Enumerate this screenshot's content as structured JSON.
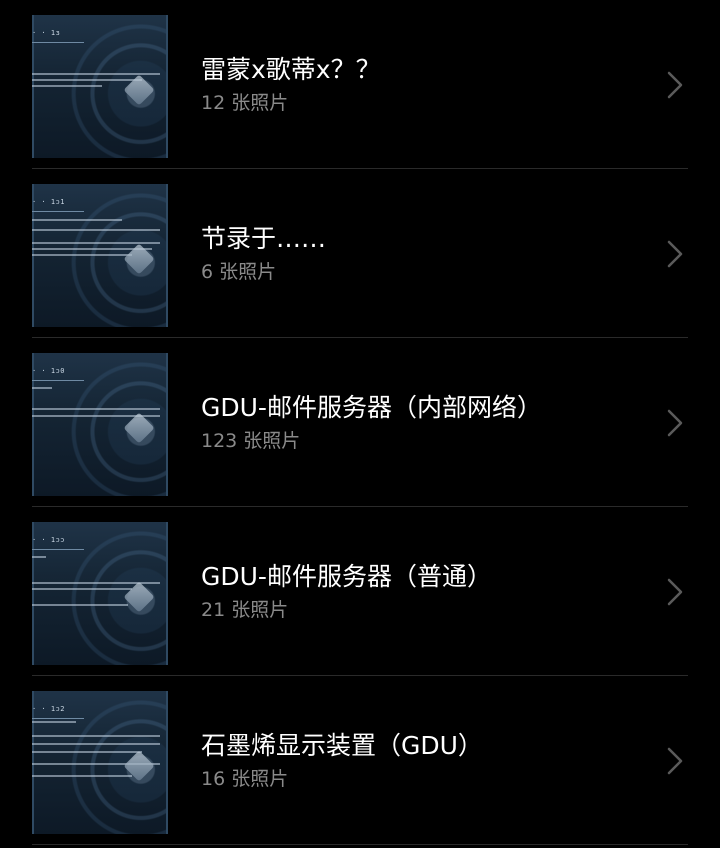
{
  "albums": [
    {
      "title": "雷蒙x歌蒂x？？",
      "count": "12 张照片",
      "thumb_label": "· ·     1ɜ"
    },
    {
      "title": "节录于……",
      "count": "6 张照片",
      "thumb_label": "· ·     1ɔ1"
    },
    {
      "title": "GDU-邮件服务器（内部网络）",
      "count": "123 张照片",
      "thumb_label": "· ·     1ɔ0"
    },
    {
      "title": "GDU-邮件服务器（普通）",
      "count": "21 张照片",
      "thumb_label": "· ·     1ɔɔ"
    },
    {
      "title": "石墨烯显示装置（GDU）",
      "count": "16 张照片",
      "thumb_label": "· ·     1ɔ2"
    }
  ],
  "icons": {
    "chevron": "chevron-right-icon"
  },
  "colors": {
    "background": "#000000",
    "title": "#ffffff",
    "count": "#8a8a8a",
    "divider": "#2a2a2a",
    "chevron": "#5a5a5a"
  }
}
